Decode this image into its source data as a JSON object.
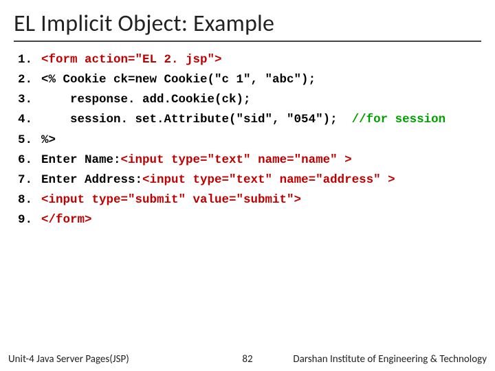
{
  "title": "EL Implicit Object: Example",
  "code": {
    "lines": [
      {
        "n": "1.",
        "pre": "",
        "span1": "<form action=\"EL 2. jsp\">",
        "mid": "",
        "span2": "",
        "post": "",
        "c1": "red",
        "c2": ""
      },
      {
        "n": "2.",
        "pre": "<% Cookie ck=new Cookie(\"c 1\", \"abc\");",
        "span1": "",
        "mid": "",
        "span2": "",
        "post": "",
        "c1": "",
        "c2": ""
      },
      {
        "n": "3.",
        "pre": "    response. add.Cookie(ck);",
        "span1": "",
        "mid": "",
        "span2": "",
        "post": "",
        "c1": "",
        "c2": ""
      },
      {
        "n": "4.",
        "pre": "    session. set.Attribute(\"sid\", \"054\");  ",
        "span1": "//for session",
        "mid": "",
        "span2": "",
        "post": "",
        "c1": "green",
        "c2": ""
      },
      {
        "n": "5.",
        "pre": "%>",
        "span1": "",
        "mid": "",
        "span2": "",
        "post": "",
        "c1": "",
        "c2": ""
      },
      {
        "n": "6.",
        "pre": "Enter Name:",
        "span1": "<input type=\"text\" name=\"name\" >",
        "mid": "",
        "span2": "",
        "post": "",
        "c1": "red",
        "c2": ""
      },
      {
        "n": "7.",
        "pre": "Enter Address:",
        "span1": "<input type=\"text\" name=\"address\" >",
        "mid": "",
        "span2": "",
        "post": "",
        "c1": "red",
        "c2": ""
      },
      {
        "n": "8.",
        "pre": "",
        "span1": "<input type=\"submit\" value=\"submit\">",
        "mid": "",
        "span2": "",
        "post": "",
        "c1": "red",
        "c2": ""
      },
      {
        "n": "9.",
        "pre": "",
        "span1": "</form>",
        "mid": "",
        "span2": "",
        "post": "",
        "c1": "red",
        "c2": ""
      }
    ]
  },
  "footer": {
    "left": "Unit-4 Java Server Pages(JSP)",
    "page": "82",
    "right": "Darshan Institute of Engineering & Technology"
  }
}
